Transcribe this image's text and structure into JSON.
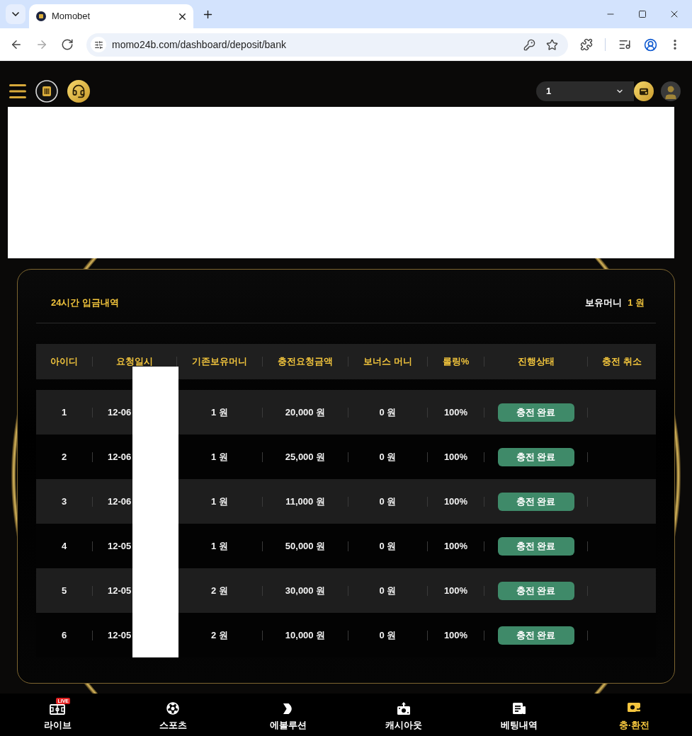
{
  "browser": {
    "tab_title": "Momobet",
    "url": "momo24b.com/dashboard/deposit/bank",
    "nav_buttons": [
      {
        "kind": "back",
        "disabled": false
      },
      {
        "kind": "forward",
        "disabled": true
      },
      {
        "kind": "reload",
        "disabled": false
      }
    ]
  },
  "header": {
    "balance_select": {
      "value": "1"
    }
  },
  "deposit_history": {
    "title": "24시간 입금내역",
    "balance_label": "보유머니",
    "balance_value": "1 원",
    "columns": [
      "아이디",
      "요청일시",
      "기존보유머니",
      "충전요청금액",
      "보너스 머니",
      "롤링%",
      "진행상태",
      "충전 취소"
    ],
    "rows": [
      {
        "id": "1",
        "requested_at": "12-06",
        "previous_balance": "1 원",
        "requested_amount": "20,000 원",
        "bonus": "0 원",
        "rolling": "100%",
        "status": "충전 완료"
      },
      {
        "id": "2",
        "requested_at": "12-06",
        "previous_balance": "1 원",
        "requested_amount": "25,000 원",
        "bonus": "0 원",
        "rolling": "100%",
        "status": "충전 완료"
      },
      {
        "id": "3",
        "requested_at": "12-06",
        "previous_balance": "1 원",
        "requested_amount": "11,000 원",
        "bonus": "0 원",
        "rolling": "100%",
        "status": "충전 완료"
      },
      {
        "id": "4",
        "requested_at": "12-05",
        "previous_balance": "1 원",
        "requested_amount": "50,000 원",
        "bonus": "0 원",
        "rolling": "100%",
        "status": "충전 완료"
      },
      {
        "id": "5",
        "requested_at": "12-05",
        "previous_balance": "2 원",
        "requested_amount": "30,000 원",
        "bonus": "0 원",
        "rolling": "100%",
        "status": "충전 완료"
      },
      {
        "id": "6",
        "requested_at": "12-05",
        "previous_balance": "2 원",
        "requested_amount": "10,000 원",
        "bonus": "0 원",
        "rolling": "100%",
        "status": "충전 완료"
      }
    ]
  },
  "bottom_nav": [
    {
      "label": "라이브",
      "badge": "LIVE",
      "selected": false
    },
    {
      "label": "스포츠",
      "selected": false
    },
    {
      "label": "에볼루션",
      "selected": false
    },
    {
      "label": "캐시아웃",
      "selected": false
    },
    {
      "label": "베팅내역",
      "selected": false
    },
    {
      "label": "충·환전",
      "selected": true
    }
  ]
}
